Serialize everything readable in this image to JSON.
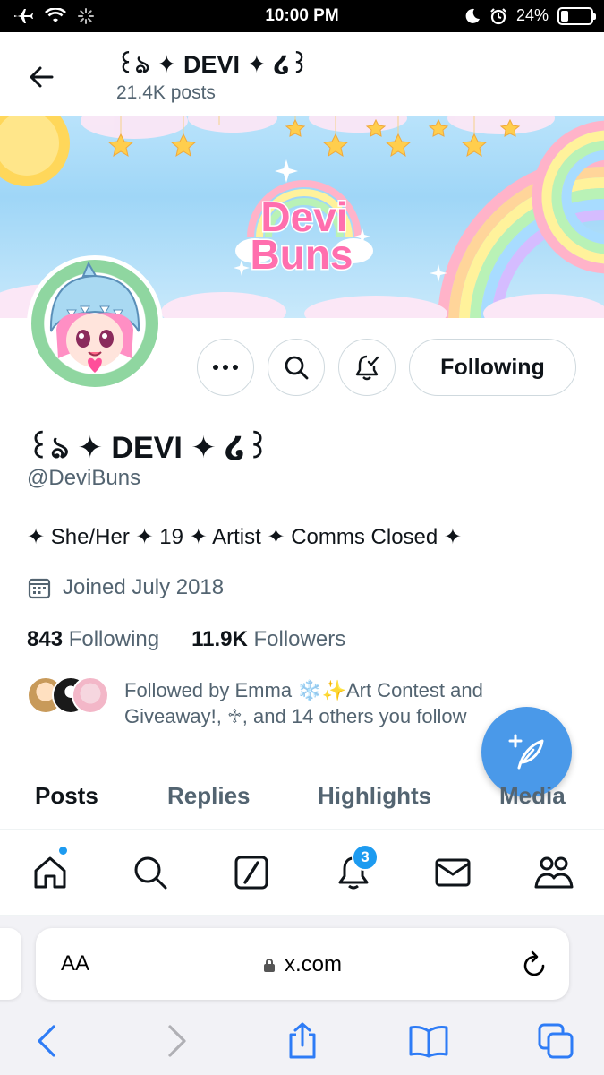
{
  "status_bar": {
    "time": "10:00 PM",
    "battery": "24%",
    "battery_level": 0.24,
    "icons": [
      "airplane-icon",
      "wifi-icon",
      "activity-spinner-icon",
      "moon-icon",
      "alarm-icon",
      "battery-icon"
    ]
  },
  "header": {
    "name": "꒰ঌ ✦ DEVI ✦ ໒꒱",
    "posts": "21.4K posts"
  },
  "profile": {
    "name": "꒰ঌ ✦ DEVI ✦ ໒꒱",
    "handle": "@DeviBuns",
    "bio": "✦ She/Her ✦ 19 ✦ Artist ✦ Comms Closed ✦",
    "joined": "Joined July 2018",
    "following_count": "843",
    "following_label": "Following",
    "followers_count": "11.9K",
    "followers_label": "Followers",
    "followed_by": "Followed by Emma ❄️✨Art Contest and Giveaway!, ♱, and 14 others you follow"
  },
  "banner": {
    "logo_line1": "Devi",
    "logo_line2": "Buns"
  },
  "actions": {
    "following_button": "Following"
  },
  "tabs": [
    {
      "label": "Posts",
      "active": true
    },
    {
      "label": "Replies",
      "active": false
    },
    {
      "label": "Highlights",
      "active": false
    },
    {
      "label": "Media",
      "active": false
    }
  ],
  "bottom_nav": {
    "notifications_badge": "3",
    "items": [
      "home-icon",
      "search-icon",
      "grok-icon",
      "notifications-icon",
      "messages-icon",
      "communities-icon"
    ]
  },
  "safari": {
    "aa_label": "AA",
    "url": "x.com"
  },
  "colors": {
    "accent": "#1d9bf0",
    "fab": "#4a99e9",
    "muted_text": "#536471"
  }
}
